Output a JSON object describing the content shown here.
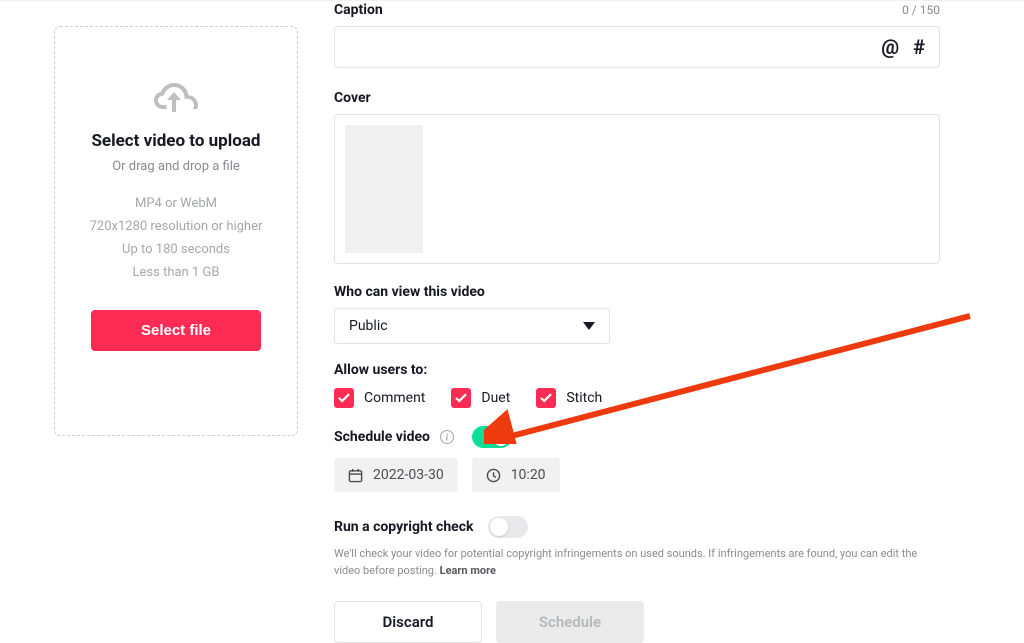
{
  "upload": {
    "title": "Select video to upload",
    "subtitle": "Or drag and drop a file",
    "meta": {
      "format": "MP4 or WebM",
      "resolution": "720x1280 resolution or higher",
      "duration": "Up to 180 seconds",
      "size": "Less than 1 GB"
    },
    "select_button": "Select file"
  },
  "caption": {
    "label": "Caption",
    "count_text": "0 / 150",
    "mention_glyph": "@",
    "hashtag_glyph": "#",
    "value": ""
  },
  "cover": {
    "label": "Cover"
  },
  "visibility": {
    "label": "Who can view this video",
    "selected": "Public"
  },
  "allow": {
    "label": "Allow users to:",
    "options": {
      "comment": "Comment",
      "duet": "Duet",
      "stitch": "Stitch"
    }
  },
  "schedule": {
    "label": "Schedule video",
    "date": "2022-03-30",
    "time": "10:20"
  },
  "copyright": {
    "label": "Run a copyright check",
    "desc_prefix": "We'll check your video for potential copyright infringements on used sounds. If infringements are found, you can edit the video before posting. ",
    "learn_more": "Learn more"
  },
  "actions": {
    "discard": "Discard",
    "schedule": "Schedule"
  },
  "colors": {
    "accent": "#fe2c55",
    "toggle_on": "#0be09b",
    "arrow": "#ed3b0f"
  }
}
